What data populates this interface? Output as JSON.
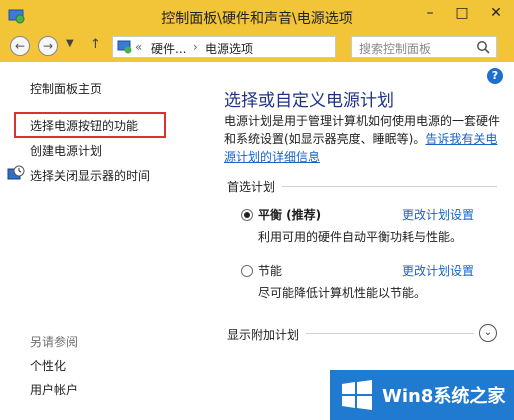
{
  "window": {
    "title": "控制面板\\硬件和声音\\电源选项"
  },
  "address": {
    "crumb_1": "硬件...",
    "separator": "›",
    "crumb_2": "电源选项"
  },
  "search": {
    "placeholder": "搜索控制面板"
  },
  "sidebar": {
    "home": "控制面板主页",
    "items": [
      {
        "label": "选择电源按钮的功能"
      },
      {
        "label": "创建电源计划"
      },
      {
        "label": "选择关闭显示器的时间"
      }
    ],
    "see_also_title": "另请参阅",
    "see_also": [
      {
        "label": "个性化"
      },
      {
        "label": "用户帐户"
      }
    ]
  },
  "main": {
    "title": "选择或自定义电源计划",
    "desc": "电源计划是用于管理计算机如何使用电源的一套硬件和系统设置(如显示器亮度、睡眠等)。",
    "desc_link": "告诉我有关电源计划的详细信息",
    "preferred_label": "首选计划",
    "plans": [
      {
        "name": "平衡 (推荐)",
        "desc": "利用可用的硬件自动平衡功耗与性能。",
        "link": "更改计划设置",
        "selected": true
      },
      {
        "name": "节能",
        "desc": "尽可能降低计算机性能以节能。",
        "link": "更改计划设置",
        "selected": false
      }
    ],
    "additional_label": "显示附加计划"
  },
  "watermark": {
    "text": "Win8系统之家"
  },
  "colors": {
    "titlebar": "#f2c437",
    "title_blue": "#1e3287",
    "link": "#1a62c5",
    "highlight": "#d9322f",
    "watermark": "#1f7ad0"
  }
}
